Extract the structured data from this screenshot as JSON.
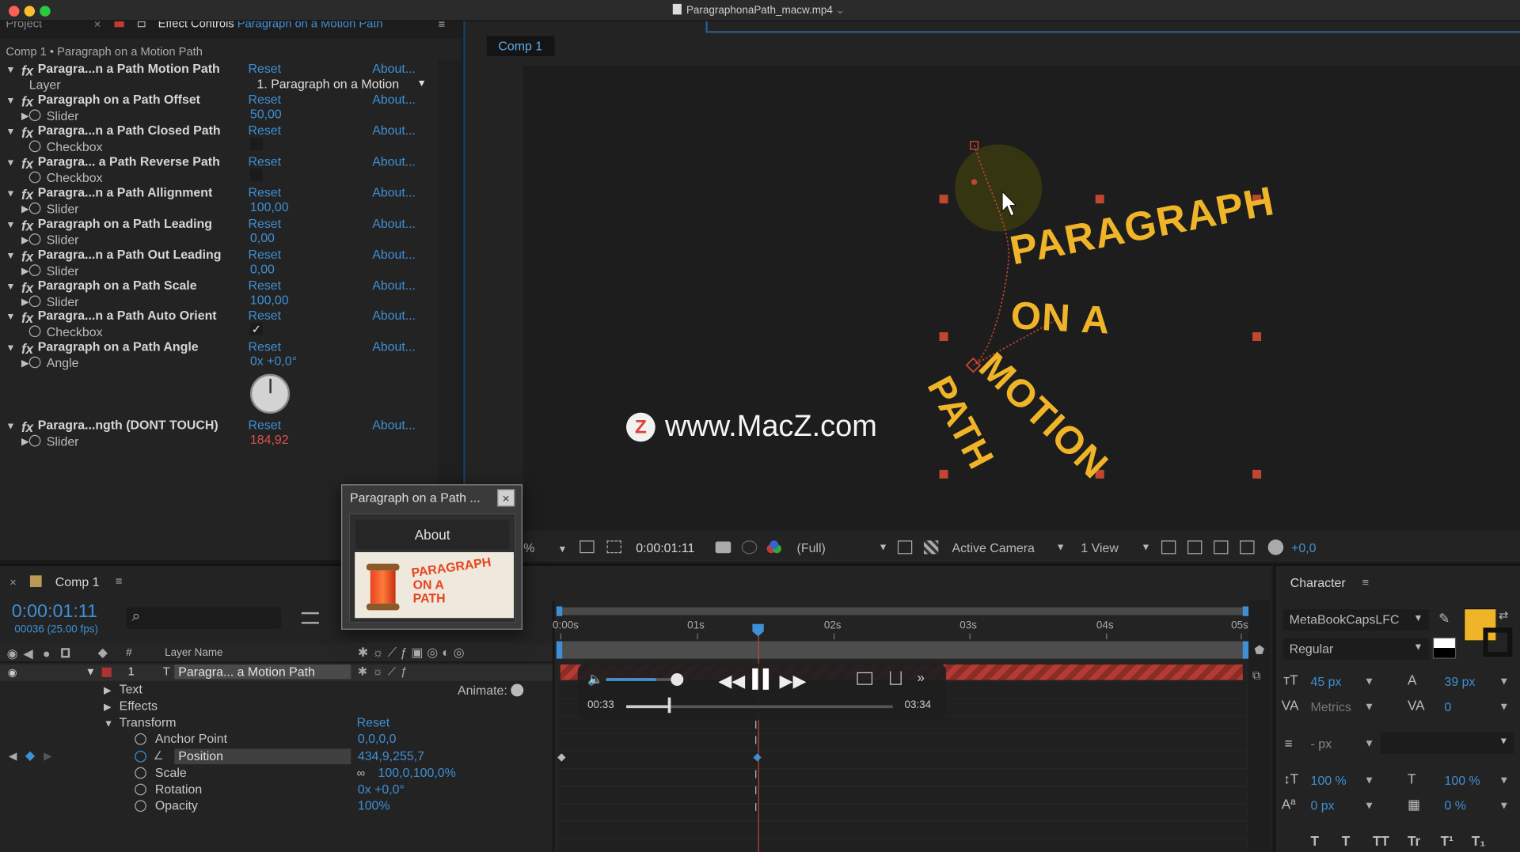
{
  "window": {
    "title": "ParagraphonaPath_macw.mp4",
    "title_chevron": "⌄"
  },
  "panel_tabs": {
    "project": "Project",
    "close_x": "×",
    "effect_controls": "Effect Controls",
    "effect_target": "Paragraph on a Motion Path",
    "menu": "≡"
  },
  "effect_header": "Comp 1 • Paragraph on a Motion Path",
  "effects": [
    {
      "name": "Paragra...n a Path Motion Path",
      "reset": "Reset",
      "about": "About...",
      "sub_label": "Layer",
      "sub_value": "1. Paragraph on a Motion"
    },
    {
      "name": "Paragraph on a Path Offset",
      "reset": "Reset",
      "about": "About...",
      "sub_label": "Slider",
      "sub_value": "50,00"
    },
    {
      "name": "Paragra...n a Path Closed Path",
      "reset": "Reset",
      "about": "About...",
      "sub_label": "Checkbox",
      "sub_value": ""
    },
    {
      "name": "Paragra... a Path Reverse Path",
      "reset": "Reset",
      "about": "About...",
      "sub_label": "Checkbox",
      "sub_value": ""
    },
    {
      "name": "Paragra...n a Path Allignment",
      "reset": "Reset",
      "about": "About...",
      "sub_label": "Slider",
      "sub_value": "100,00"
    },
    {
      "name": "Paragraph on a Path Leading",
      "reset": "Reset",
      "about": "About...",
      "sub_label": "Slider",
      "sub_value": "0,00"
    },
    {
      "name": "Paragra...n a Path Out Leading",
      "reset": "Reset",
      "about": "About...",
      "sub_label": "Slider",
      "sub_value": "0,00"
    },
    {
      "name": "Paragraph on a Path Scale",
      "reset": "Reset",
      "about": "About...",
      "sub_label": "Slider",
      "sub_value": "100,00"
    },
    {
      "name": "Paragra...n a Path Auto Orient",
      "reset": "Reset",
      "about": "About...",
      "sub_label": "Checkbox",
      "sub_value": "✓"
    },
    {
      "name": "Paragraph on a Path Angle",
      "reset": "Reset",
      "about": "About...",
      "sub_label": "Angle",
      "sub_value": "0x +0,0°"
    },
    {
      "name": "Paragra...ngth (DONT TOUCH)",
      "reset": "Reset",
      "about": "About...",
      "sub_label": "Slider",
      "sub_value": "184,92"
    }
  ],
  "comp_tab": "Comp 1",
  "viewer": {
    "words": [
      "PARAGRAPH",
      "ON A",
      "MOTION",
      "PATH"
    ],
    "watermark_logo": "Z",
    "watermark": "www.MacZ.com",
    "text_color": "#f0b429"
  },
  "viewer_toolbar": {
    "zoom_suffix": "%",
    "timecode": "0:00:01:11",
    "resolution": "(Full)",
    "camera": "Active Camera",
    "view": "1 View",
    "exposure": "+0,0"
  },
  "popup": {
    "title": "Paragraph on a Path ...",
    "close": "×",
    "about": "About",
    "logo_lines": [
      "PARAGRAPH",
      "ON A",
      "PATH"
    ]
  },
  "timeline": {
    "tab": "Comp 1",
    "timecode": "0:00:01:11",
    "fps": "00036 (25.00 fps)",
    "search_icon": "⌕",
    "col_num": "#",
    "col_layer_name": "Layer Name",
    "layer_num": "1",
    "layer_name": "Paragra... a Motion Path",
    "animate": "Animate:",
    "ruler": [
      "0:00s",
      "01s",
      "02s",
      "03s",
      "04s",
      "05s"
    ],
    "props": [
      {
        "label": "Text",
        "value": ""
      },
      {
        "label": "Effects",
        "value": ""
      },
      {
        "label": "Transform",
        "value": "Reset"
      },
      {
        "label": "Anchor Point",
        "value": "0,0,0,0"
      },
      {
        "label": "Position",
        "value": "434,9,255,7"
      },
      {
        "label": "Scale",
        "value": "100,0,100,0%"
      },
      {
        "label": "Rotation",
        "value": "0x +0,0°"
      },
      {
        "label": "Opacity",
        "value": "100%"
      }
    ]
  },
  "player": {
    "elapsed": "00:33",
    "total": "03:34",
    "volume": 0.65,
    "progress": 0.16
  },
  "character": {
    "title": "Character",
    "menu": "≡",
    "font": "MetaBookCapsLFC",
    "style": "Regular",
    "size": "45 px",
    "leading": "39 px",
    "kerning": "Metrics",
    "tracking": "0",
    "stroke_unit": "- px",
    "vscale": "100 %",
    "hscale": "100 %",
    "baseline": "0 px",
    "tsume": "0 %",
    "fill_color": "#f0b429",
    "styles": [
      "T",
      "T",
      "TT",
      "Tr",
      "T¹",
      "T₁"
    ]
  }
}
